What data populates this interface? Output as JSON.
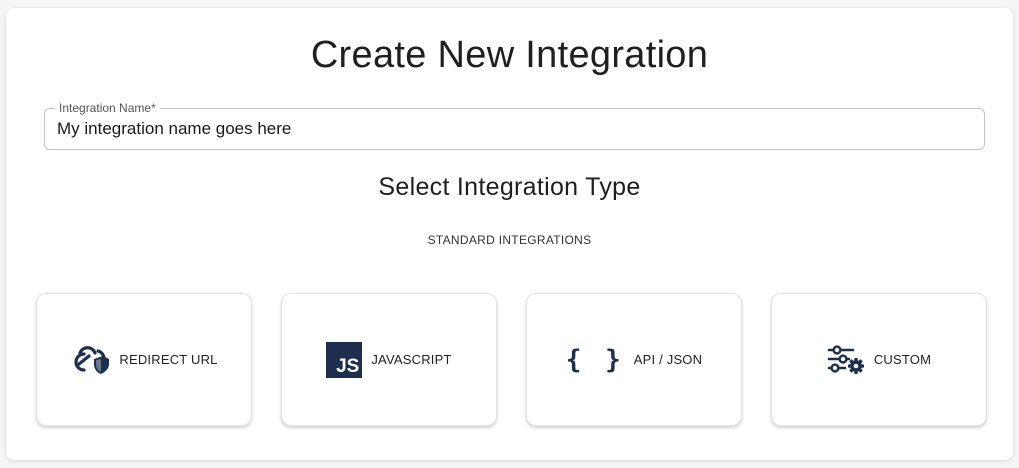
{
  "page": {
    "title": "Create New Integration",
    "subtitle": "Select Integration Type",
    "section_label": "STANDARD INTEGRATIONS"
  },
  "form": {
    "name_label": "Integration Name",
    "required_marker": "*",
    "name_value": "My integration name goes here"
  },
  "cards": [
    {
      "label": "REDIRECT URL",
      "icon": "link-shield-icon"
    },
    {
      "label": "JAVASCRIPT",
      "icon": "javascript-icon",
      "icon_text": "JS"
    },
    {
      "label": "API / JSON",
      "icon": "curly-braces-icon",
      "icon_text": "{ }"
    },
    {
      "label": "CUSTOM",
      "icon": "sliders-gear-icon"
    }
  ],
  "colors": {
    "icon_navy": "#1d2e4f",
    "card_border": "#e2e2e2",
    "field_border": "#c4c4c4"
  }
}
